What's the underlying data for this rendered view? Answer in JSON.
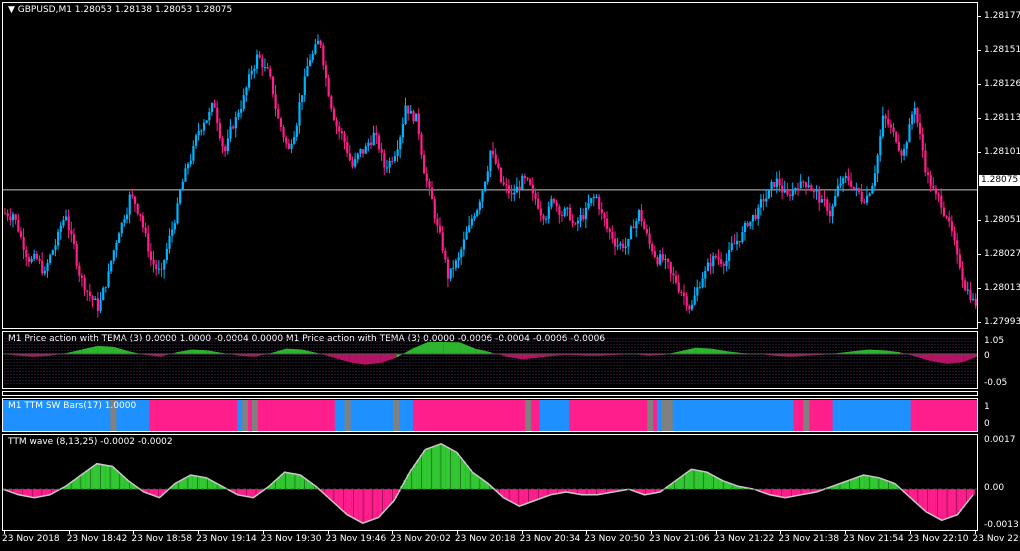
{
  "window": {
    "symbol_line": "▼ GBPUSD,M1  1.28053  1.28138  1.28053  1.28075",
    "current_price": "1.28075"
  },
  "colors": {
    "bull": "#00b4ff",
    "bear": "#ff1e8c",
    "green": "#32c832",
    "gray": "#808080",
    "blue_bar": "#1e90ff"
  },
  "price_axis": [
    "1.28177",
    "1.28151",
    "1.28126",
    "1.28113",
    "1.28101",
    "1.28075",
    "1.28051",
    "1.28027",
    "1.28003",
    "1.27993",
    "1.28013"
  ],
  "time_axis": [
    "23 Nov 2018",
    "23 Nov 18:42",
    "23 Nov 18:58",
    "23 Nov 19:14",
    "23 Nov 19:30",
    "23 Nov 19:46",
    "23 Nov 20:02",
    "23 Nov 20:18",
    "23 Nov 20:34",
    "23 Nov 20:50",
    "23 Nov 21:06",
    "23 Nov 21:22",
    "23 Nov 21:38",
    "23 Nov 21:54",
    "23 Nov 22:10",
    "23 Nov 22:26"
  ],
  "sub1": {
    "title": "M1 Price action with TEMA (3) 0.0000 1.0000 -0.0004 0.0000   M1 Price action with TEMA (3) 0.0000 -0.0006 -0.0004 -0.0006 -0.0006",
    "axis": [
      "1.05",
      "0",
      "-0.05"
    ]
  },
  "sub2": {
    "title": "M1  TTM SW Bars(17) 1.0000",
    "axis": [
      "1",
      "0"
    ]
  },
  "sub3": {
    "title": "TTM wave (8,13,25) -0.0002 -0.0002",
    "axis": [
      "0.0017",
      "0.00",
      "-0.0013"
    ]
  },
  "chart_data": [
    {
      "type": "candlestick",
      "title": "GBPUSD,M1  1.28053  1.28138  1.28053  1.28075",
      "ylim": [
        1.27985,
        1.28195
      ],
      "y_ticks": [
        1.28177,
        1.28151,
        1.28126,
        1.28101,
        1.28075,
        1.28051,
        1.28027,
        1.28003,
        1.27993,
        1.28013,
        1.28113
      ],
      "x_ticks": [
        "23 Nov 2018",
        "23 Nov 18:42",
        "23 Nov 18:58",
        "23 Nov 19:14",
        "23 Nov 19:30",
        "23 Nov 19:46",
        "23 Nov 20:02",
        "23 Nov 20:18",
        "23 Nov 20:34",
        "23 Nov 20:50",
        "23 Nov 21:06",
        "23 Nov 21:22",
        "23 Nov 21:38",
        "23 Nov 21:54",
        "23 Nov 22:10",
        "23 Nov 22:26"
      ],
      "close_series": [
        1.2806,
        1.2804,
        1.2803,
        1.2802,
        1.2804,
        1.2806,
        1.2803,
        1.2801,
        1.28,
        1.2802,
        1.2805,
        1.2807,
        1.2806,
        1.2803,
        1.2802,
        1.2805,
        1.2808,
        1.281,
        1.2812,
        1.2813,
        1.281,
        1.2812,
        1.2814,
        1.2816,
        1.2815,
        1.2812,
        1.281,
        1.2813,
        1.2816,
        1.2817,
        1.2813,
        1.2811,
        1.2809,
        1.281,
        1.2811,
        1.2809,
        1.281,
        1.2813,
        1.2812,
        1.2808,
        1.2805,
        1.2802,
        1.2803,
        1.2805,
        1.2807,
        1.281,
        1.2808,
        1.2807,
        1.2808,
        1.2807,
        1.2806,
        1.2807,
        1.2806,
        1.2805,
        1.2806,
        1.2807,
        1.2805,
        1.2804,
        1.2804,
        1.2806,
        1.2804,
        1.2803,
        1.2802,
        1.2801,
        1.28,
        1.2802,
        1.2803,
        1.2803,
        1.2804,
        1.2805,
        1.2806,
        1.2807,
        1.2808,
        1.2807,
        1.2808,
        1.2808,
        1.2807,
        1.2806,
        1.2808,
        1.2808,
        1.2807,
        1.2808,
        1.2812,
        1.2811,
        1.281,
        1.2813,
        1.2809,
        1.2807,
        1.2806,
        1.2803,
        1.2801,
        1.28
      ],
      "up_color": "#00b4ff",
      "down_color": "#ff1e8c"
    },
    {
      "type": "histogram",
      "title": "M1 Price action with TEMA (3)",
      "ylim": [
        -0.05,
        1.05
      ]
    },
    {
      "type": "bar",
      "title": "M1  TTM SW Bars(17) 1.0000",
      "segments": [
        {
          "color": "blue",
          "from": 0,
          "to": 0.15
        },
        {
          "color": "pink",
          "from": 0.15,
          "to": 0.24
        },
        {
          "color": "blue",
          "from": 0.24,
          "to": 0.25
        },
        {
          "color": "pink",
          "from": 0.25,
          "to": 0.34
        },
        {
          "color": "blue",
          "from": 0.34,
          "to": 0.42
        },
        {
          "color": "pink",
          "from": 0.42,
          "to": 0.55
        },
        {
          "color": "blue",
          "from": 0.55,
          "to": 0.58
        },
        {
          "color": "pink",
          "from": 0.58,
          "to": 0.67
        },
        {
          "color": "blue",
          "from": 0.67,
          "to": 0.81
        },
        {
          "color": "pink",
          "from": 0.81,
          "to": 0.85
        },
        {
          "color": "blue",
          "from": 0.85,
          "to": 0.93
        },
        {
          "color": "pink",
          "from": 0.93,
          "to": 1.0
        }
      ],
      "ylim": [
        0,
        1
      ]
    },
    {
      "type": "histogram",
      "title": "TTM wave (8,13,25) -0.0002 -0.0002",
      "ylim": [
        -0.0013,
        0.0017
      ],
      "wave": [
        0.0,
        -0.0002,
        -0.0003,
        -0.0002,
        0.0001,
        0.0005,
        0.0009,
        0.0008,
        0.0003,
        -0.0001,
        -0.0003,
        0.0002,
        0.0005,
        0.0004,
        0.0001,
        -0.0002,
        -0.0003,
        0.0001,
        0.0006,
        0.0005,
        0.0001,
        -0.0004,
        -0.0009,
        -0.0012,
        -0.001,
        -0.0004,
        0.0006,
        0.0014,
        0.0016,
        0.0013,
        0.0006,
        0.0002,
        -0.0003,
        -0.0006,
        -0.0004,
        -0.0002,
        -0.0001,
        -0.0002,
        -0.0002,
        -0.0001,
        0.0,
        -0.0002,
        -0.0001,
        0.0003,
        0.0007,
        0.0006,
        0.0003,
        0.0001,
        0.0,
        -0.0002,
        -0.0003,
        -0.0002,
        -0.0001,
        0.0001,
        0.0003,
        0.0005,
        0.0004,
        0.0002,
        -0.0003,
        -0.0008,
        -0.0011,
        -0.0009,
        -0.0002
      ]
    }
  ]
}
